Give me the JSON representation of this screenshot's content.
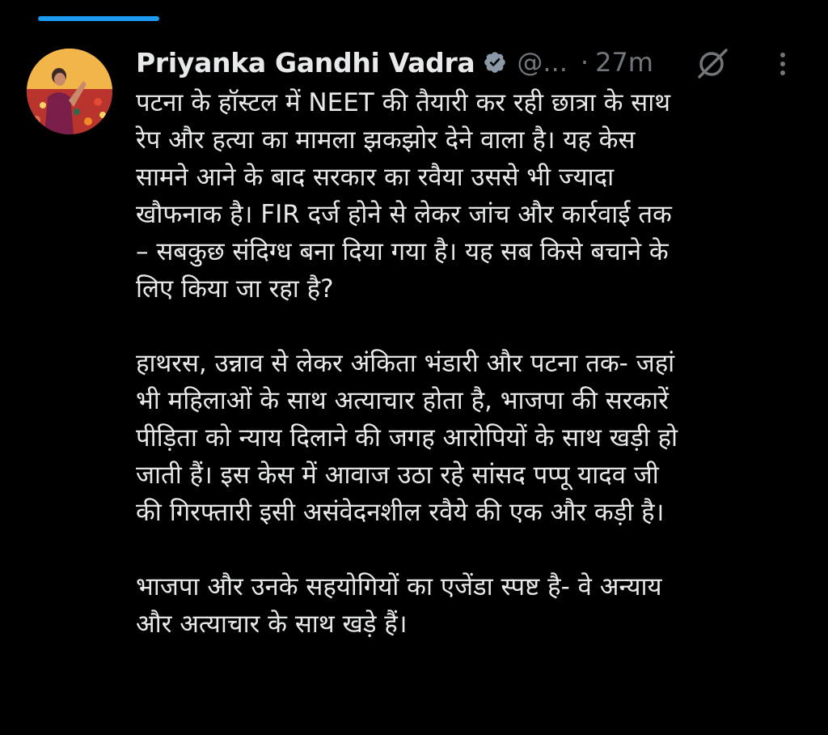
{
  "tweet": {
    "author": {
      "name": "Priyanka Gandhi Vadra",
      "handle": "@...",
      "verified": true,
      "verified_icon": "verified-badge-icon"
    },
    "separator": "·",
    "time": "27m",
    "actions": {
      "grok_icon": "grok-slash-circle-icon",
      "more_icon": "more-vertical-icon"
    },
    "paragraphs": [
      [
        "पटना के हॉस्टल में NEET की तैयारी कर रही छात्रा के साथ",
        "रेप और हत्या का मामला झकझोर देने वाला है। यह केस",
        "सामने आने के बाद सरकार का रवैया उससे भी ज्यादा",
        "खौफनाक है। FIR दर्ज होने से लेकर जांच और कार्रवाई तक",
        "– सबकुछ संदिग्ध बना दिया गया है। यह सब किसे बचाने के",
        "लिए किया जा रहा है?"
      ],
      [
        "हाथरस, उन्नाव से लेकर अंकिता भंडारी और पटना तक- जहां",
        "भी महिलाओं के साथ अत्याचार होता है, भाजपा की सरकारें",
        "पीड़िता को न्याय दिलाने की जगह आरोपियों के साथ खड़ी हो",
        "जाती हैं। इस केस में आवाज उठा रहे सांसद पप्पू यादव जी",
        "की गिरफ्तारी इसी असंवेदनशील रवैये की एक और कड़ी है।"
      ],
      [
        "भाजपा और उनके सहयोगियों का एजेंडा स्पष्ट है- वे अन्याय",
        "और अत्याचार के साथ खड़े हैं।"
      ]
    ]
  },
  "colors": {
    "background": "#000000",
    "text": "#e7e9ea",
    "muted": "#71767b",
    "accent": "#1d9bf0"
  }
}
